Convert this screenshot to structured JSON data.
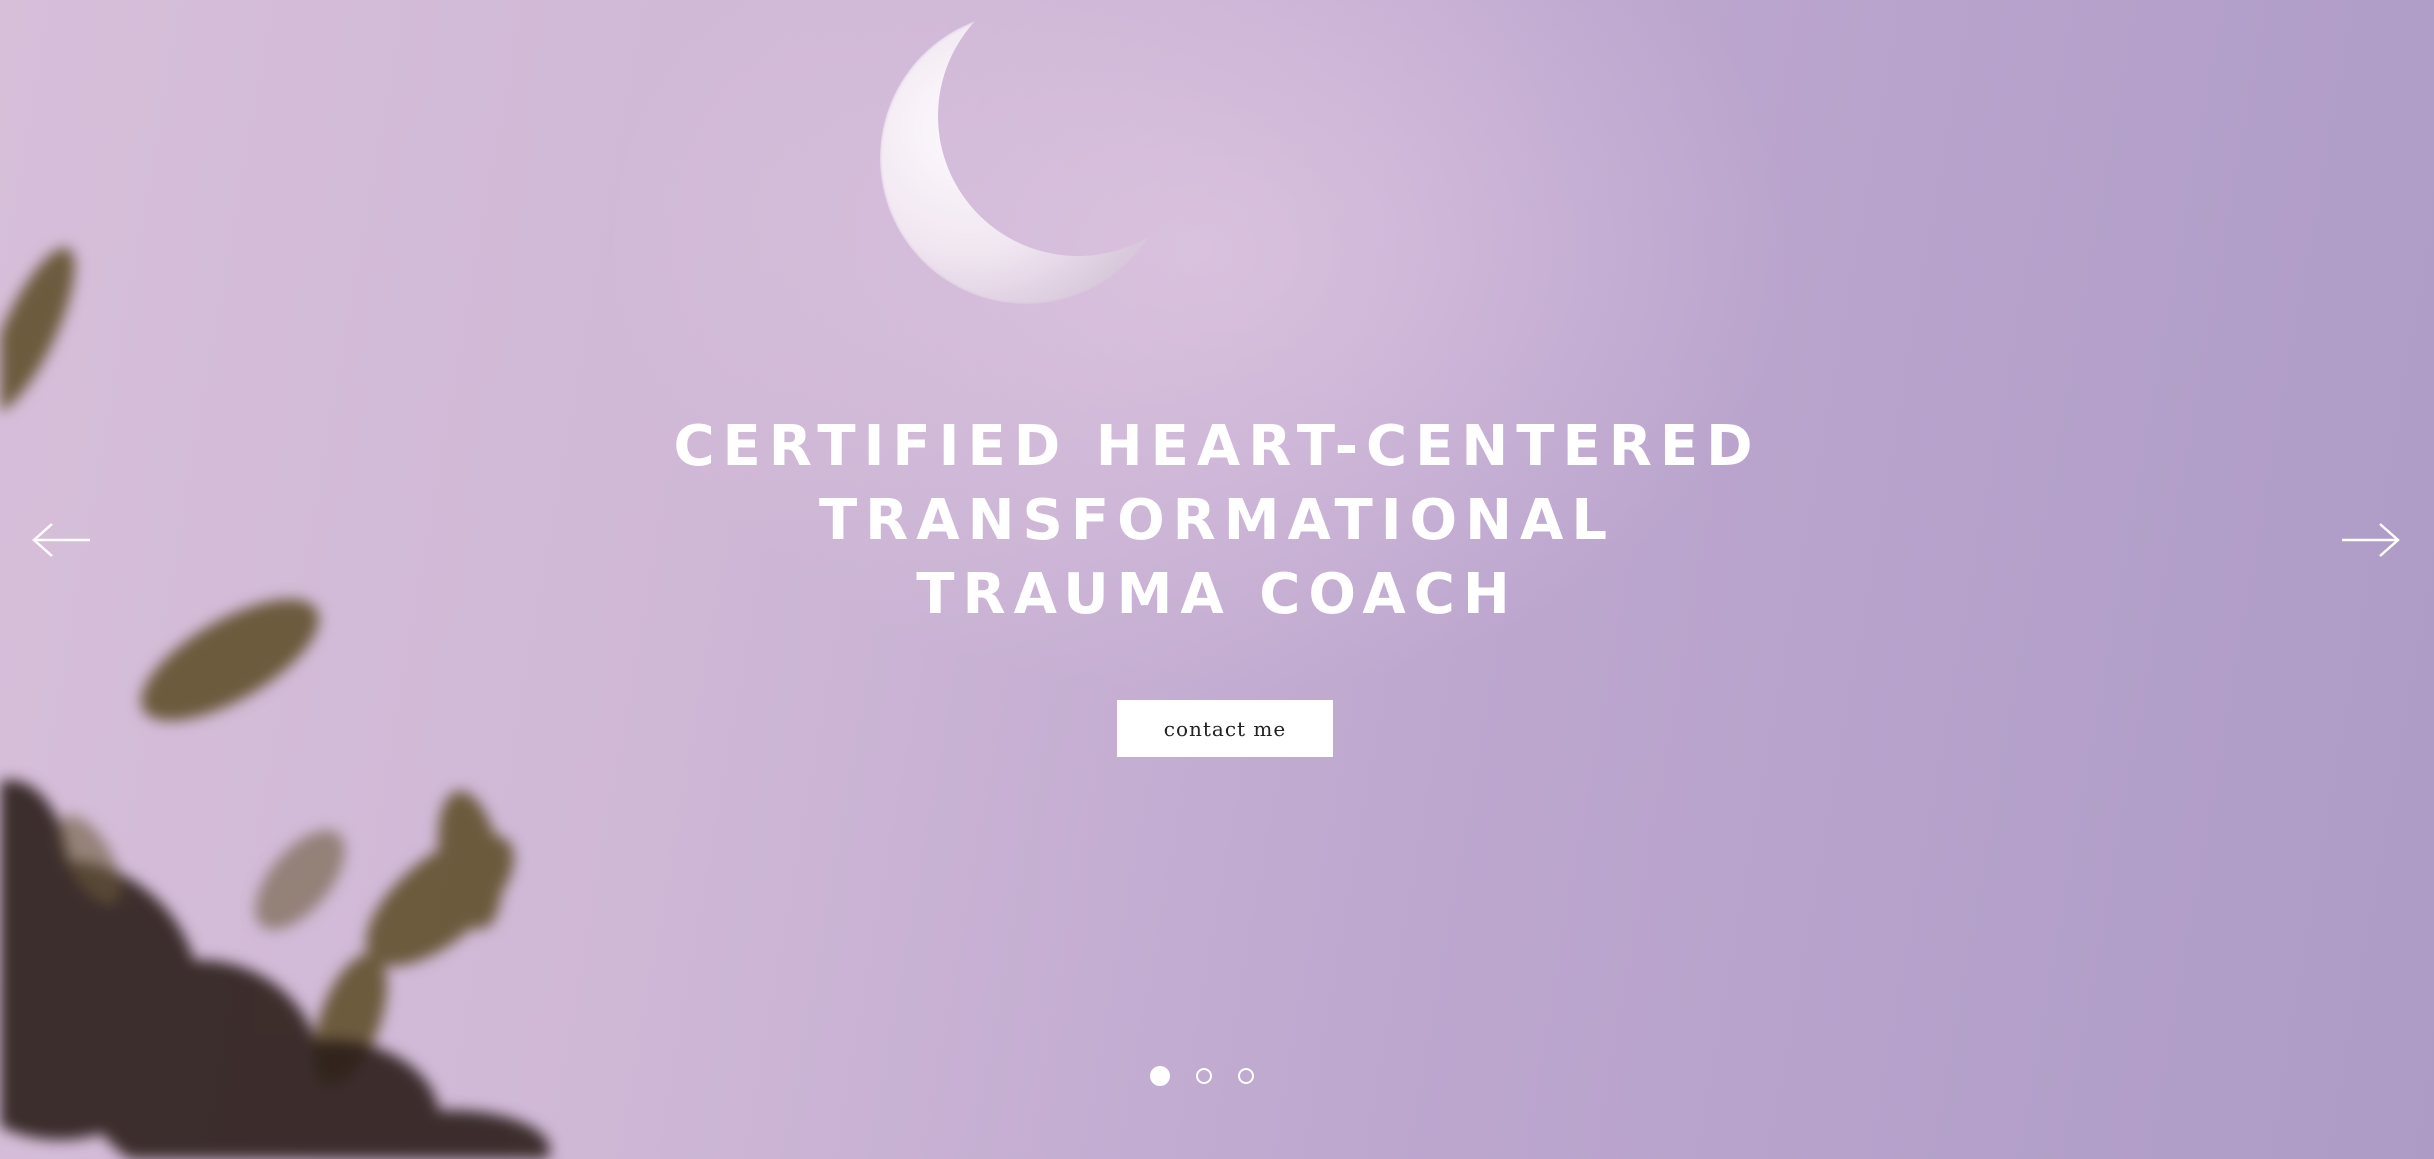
{
  "hero": {
    "headline_lines": [
      "CERTIFIED HEART-CENTERED",
      "TRANSFORMATIONAL",
      "TRAUMA COACH"
    ],
    "cta_label": "contact me",
    "background_image": "crescent-moon-lavender-sky-with-blurred-leaves",
    "colors": {
      "sky_light": "#d7bfda",
      "sky_dark": "#ad9bc6",
      "text": "#ffffff",
      "button_bg": "#ffffff",
      "button_text": "#222222"
    }
  },
  "slider": {
    "prev_icon": "arrow-left-icon",
    "next_icon": "arrow-right-icon",
    "slide_count": 3,
    "active_slide": 1
  }
}
